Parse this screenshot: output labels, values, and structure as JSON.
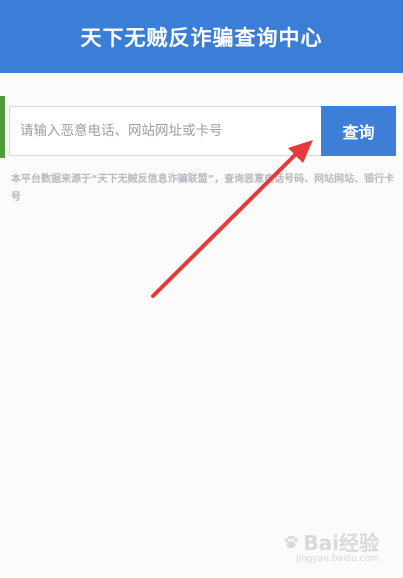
{
  "header": {
    "title": "天下无贼反诈骗查询中心"
  },
  "search": {
    "placeholder": "请输入恶意电话、网站网址或卡号",
    "button_label": "查询"
  },
  "notice": {
    "text": "本平台数据来源于“天下无贼反信息诈骗联盟”，查询恶意电话号码、网站网站、银行卡号"
  },
  "watermark": {
    "brand": "Bai经验",
    "domain": "jingyan.baidu.com"
  },
  "colors": {
    "header_bg": "#3a7ed8",
    "button_bg": "#3d7fd6",
    "arrow": "#e8393a"
  },
  "icons": {
    "annotation": "red-arrow-icon",
    "watermark": "baidu-paw-icon"
  }
}
